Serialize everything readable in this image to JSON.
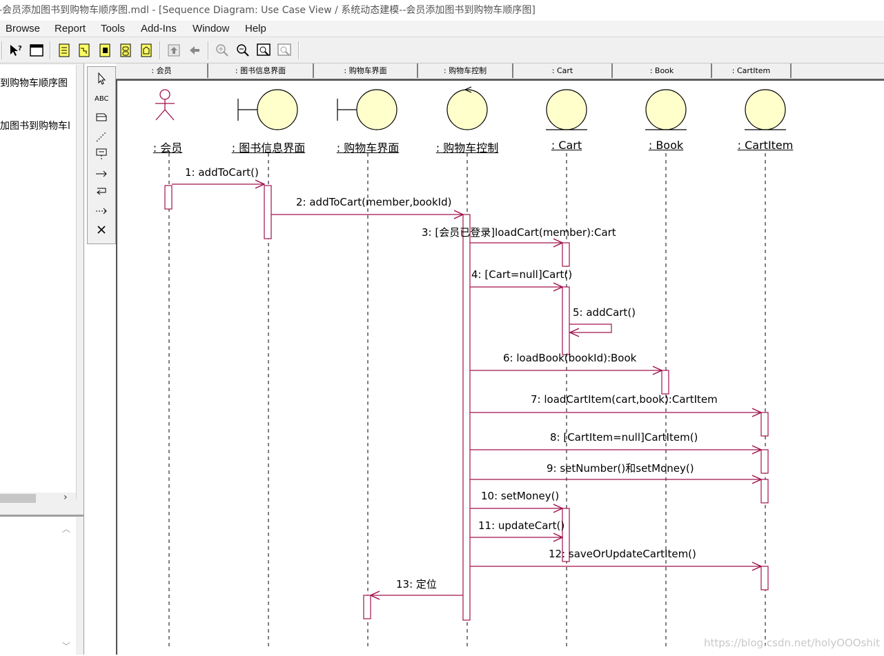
{
  "window": {
    "title": "-会员添加图书到购物车顺序图.mdl - [Sequence Diagram: Use Case View / 系统动态建模--会员添加图书到购物车顺序图]"
  },
  "menu": [
    "Browse",
    "Report",
    "Tools",
    "Add-Ins",
    "Window",
    "Help"
  ],
  "toolbar": {
    "buttons": [
      "context-help-icon",
      "view-doc-icon",
      "class-diagram-icon",
      "interaction-diagram-icon",
      "component-diagram-icon",
      "statechart-diagram-icon",
      "deployment-diagram-icon",
      "browse-parent-icon",
      "browse-previous-icon",
      "zoom-in-icon",
      "zoom-out-icon",
      "fit-in-window-icon",
      "undo-fit-icon"
    ]
  },
  "browser": {
    "items": [
      "到购物车顺序图",
      "加图书到购物车l"
    ]
  },
  "palette": {
    "tools": [
      "selection-arrow-icon",
      "text-box-icon",
      "note-icon",
      "anchor-note-icon",
      "object-icon",
      "object-message-icon",
      "message-to-self-icon",
      "return-message-icon",
      "destruction-marker-icon"
    ],
    "text_label": "ABC"
  },
  "header_cells": [
    ": 会员",
    ": 图书信息界面",
    ": 购物车界面",
    ": 购物车控制",
    ": Cart",
    ": Book",
    ": CartItem"
  ],
  "diagram": {
    "objects": [
      {
        "name": ": 会员",
        "kind": "actor"
      },
      {
        "name": ": 图书信息界面",
        "kind": "boundary"
      },
      {
        "name": ": 购物车界面",
        "kind": "boundary"
      },
      {
        "name": ": 购物车控制",
        "kind": "control"
      },
      {
        "name": ": Cart",
        "kind": "entity"
      },
      {
        "name": ": Book",
        "kind": "entity"
      },
      {
        "name": ": CartItem",
        "kind": "entity"
      }
    ],
    "messages": [
      {
        "label": "1: addToCart()",
        "from": 0,
        "to": 1
      },
      {
        "label": "2: addToCart(member,bookId)",
        "from": 1,
        "to": 3
      },
      {
        "label": "3: [会员已登录]loadCart(member):Cart",
        "from": 3,
        "to": 4
      },
      {
        "label": "4: [Cart=null]Cart()",
        "from": 3,
        "to": 4
      },
      {
        "label": "5: addCart()",
        "from": 4,
        "to": 4
      },
      {
        "label": "6: loadBook(bookId):Book",
        "from": 3,
        "to": 5
      },
      {
        "label": "7: loadCartItem(cart,book):CartItem",
        "from": 3,
        "to": 6
      },
      {
        "label": "8: [CartItem=null]CartItem()",
        "from": 3,
        "to": 6
      },
      {
        "label": "9: setNumber()和setMoney()",
        "from": 3,
        "to": 6
      },
      {
        "label": "10: setMoney()",
        "from": 3,
        "to": 4
      },
      {
        "label": "11: updateCart()",
        "from": 3,
        "to": 4
      },
      {
        "label": "12: saveOrUpdateCartItem()",
        "from": 3,
        "to": 6
      },
      {
        "label": "13: 定位",
        "from": 3,
        "to": 2
      }
    ]
  },
  "colors": {
    "message": "#a0104c",
    "object_fill": "#ffffcc"
  },
  "watermark": "https://blog.csdn.net/holyOOOshit"
}
